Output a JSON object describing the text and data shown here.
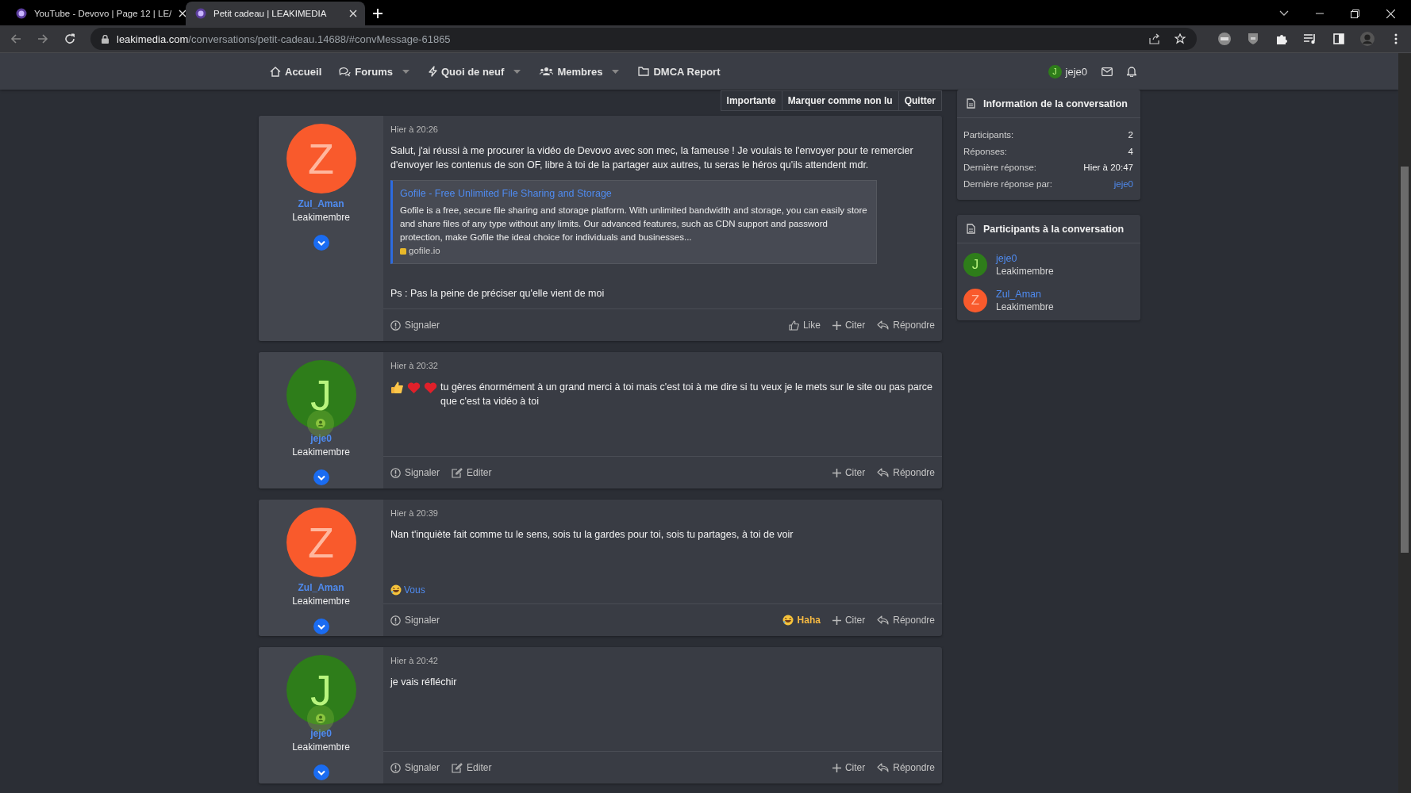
{
  "browser": {
    "tabs": [
      {
        "title": "YouTube - Devovo | Page 12 | LE/",
        "selected": false
      },
      {
        "title": "Petit cadeau | LEAKIMEDIA",
        "selected": true
      }
    ],
    "url": {
      "host": "leakimedia.com",
      "path": "/conversations/petit-cadeau.14688/#convMessage-61865"
    }
  },
  "nav": {
    "items": [
      {
        "label": "Accueil",
        "kind": "home",
        "has_dropdown": false
      },
      {
        "label": "Forums",
        "kind": "forums",
        "has_dropdown": true
      },
      {
        "label": "Quoi de neuf",
        "kind": "new",
        "has_dropdown": true
      },
      {
        "label": "Membres",
        "kind": "members",
        "has_dropdown": true
      },
      {
        "label": "DMCA Report",
        "kind": "folder",
        "has_dropdown": false
      }
    ],
    "user": {
      "initial": "J",
      "name": "jeje0",
      "color": "#2e7d1a"
    }
  },
  "conversation_actions": [
    "Importante",
    "Marquer comme non lu",
    "Quitter"
  ],
  "posts": [
    {
      "author": "Zul_Aman",
      "initial": "Z",
      "color": "#f95a2c",
      "online": false,
      "role": "Leakimembre",
      "time": "Hier à 20:26",
      "kind": "plain",
      "paragraphs": [
        "Salut, j'ai réussi à me procurer la vidéo de Devovo avec son mec, la fameuse ! Je voulais te l'envoyer pour te remercier d'envoyer les contenus de son OF, libre à toi de la partager aux autres, tu seras le héros qu'ils attendent mdr."
      ],
      "link_preview": {
        "title": "Gofile - Free Unlimited File Sharing and Storage",
        "description": "Gofile is a free, secure file sharing and storage platform. With unlimited bandwidth and storage, you can easily store and share files of any type without any limits. Our advanced features, such as CDN support and password protection, make Gofile the ideal choice for individuals and businesses...",
        "site": "gofile.io"
      },
      "after": "Ps : Pas la peine de préciser qu'elle vient de moi",
      "actions_left": [
        {
          "label": "Signaler",
          "kind": "report"
        }
      ],
      "actions_right": [
        {
          "label": "Like",
          "kind": "like",
          "reacted": false
        },
        {
          "label": "Citer",
          "kind": "quote",
          "reacted": false
        },
        {
          "label": "Répondre",
          "kind": "reply",
          "reacted": false
        }
      ]
    },
    {
      "author": "jeje0",
      "initial": "J",
      "color": "#2e7d1a",
      "online": true,
      "role": "Leakimembre",
      "time": "Hier à 20:32",
      "kind": "emoji_lead",
      "paragraphs": [
        "tu gères énormément à un grand merci à toi mais c'est toi à me dire si tu veux je le mets sur le site ou pas parce que c'est ta vidéo à toi"
      ],
      "actions_left": [
        {
          "label": "Signaler",
          "kind": "report"
        },
        {
          "label": "Editer",
          "kind": "edit"
        }
      ],
      "actions_right": [
        {
          "label": "Citer",
          "kind": "quote",
          "reacted": false
        },
        {
          "label": "Répondre",
          "kind": "reply",
          "reacted": false
        }
      ]
    },
    {
      "author": "Zul_Aman",
      "initial": "Z",
      "color": "#f95a2c",
      "online": false,
      "role": "Leakimembre",
      "time": "Hier à 20:39",
      "kind": "plain",
      "paragraphs": [
        "Nan t'inquiète fait comme tu le sens, sois tu la gardes pour toi, sois tu partages, à toi de voir"
      ],
      "reactions": "Vous",
      "actions_left": [
        {
          "label": "Signaler",
          "kind": "report"
        }
      ],
      "actions_right": [
        {
          "label": "Haha",
          "kind": "haha",
          "reacted": true
        },
        {
          "label": "Citer",
          "kind": "quote",
          "reacted": false
        },
        {
          "label": "Répondre",
          "kind": "reply",
          "reacted": false
        }
      ]
    },
    {
      "author": "jeje0",
      "initial": "J",
      "color": "#2e7d1a",
      "online": true,
      "role": "Leakimembre",
      "time": "Hier à 20:42",
      "kind": "plain",
      "paragraphs": [
        "je vais réfléchir"
      ],
      "actions_left": [
        {
          "label": "Signaler",
          "kind": "report"
        },
        {
          "label": "Editer",
          "kind": "edit"
        }
      ],
      "actions_right": [
        {
          "label": "Citer",
          "kind": "quote",
          "reacted": false
        },
        {
          "label": "Répondre",
          "kind": "reply",
          "reacted": false
        }
      ]
    }
  ],
  "sidebar": {
    "info": {
      "title": "Information de la conversation",
      "rows": [
        {
          "label": "Participants:",
          "value": "2",
          "kind": "text"
        },
        {
          "label": "Réponses:",
          "value": "4",
          "kind": "text"
        },
        {
          "label": "Dernière réponse:",
          "value": "Hier à 20:47",
          "kind": "text"
        },
        {
          "label": "Dernière réponse par:",
          "value": "jeje0",
          "kind": "link"
        }
      ]
    },
    "participants": {
      "title": "Participants à la conversation",
      "members": [
        {
          "name": "jeje0",
          "role": "Leakimembre",
          "initial": "J",
          "color": "#2e7d1a"
        },
        {
          "name": "Zul_Aman",
          "role": "Leakimembre",
          "initial": "Z",
          "color": "#f95a2c"
        }
      ]
    }
  }
}
